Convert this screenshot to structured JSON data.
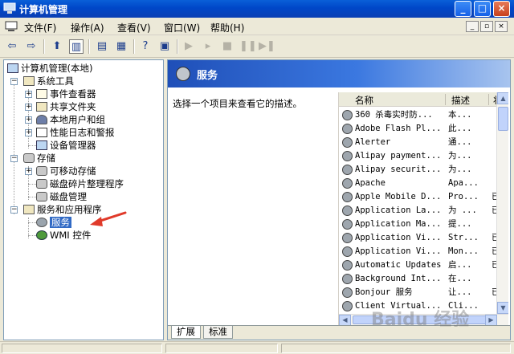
{
  "window": {
    "title": "计算机管理"
  },
  "menubar": {
    "items": [
      "文件(F)",
      "操作(A)",
      "查看(V)",
      "窗口(W)",
      "帮助(H)"
    ]
  },
  "tree": {
    "root": "计算机管理(本地)",
    "system_tools": "系统工具",
    "event_viewer": "事件查看器",
    "shared_folders": "共享文件夹",
    "local_users": "本地用户和组",
    "perf_logs": "性能日志和警报",
    "device_manager": "设备管理器",
    "storage": "存储",
    "removable_storage": "可移动存储",
    "defrag": "磁盘碎片整理程序",
    "disk_management": "磁盘管理",
    "services_apps": "服务和应用程序",
    "services": "服务",
    "wmi": "WMI 控件"
  },
  "details": {
    "header_title": "服务",
    "description_prompt": "选择一个项目来查看它的描述。",
    "columns": [
      "名称",
      "描述",
      "状"
    ],
    "rows": [
      {
        "name": "360 杀毒实时防...",
        "desc": "本...",
        "status": ""
      },
      {
        "name": "Adobe Flash Pl...",
        "desc": "此...",
        "status": ""
      },
      {
        "name": "Alerter",
        "desc": "通...",
        "status": ""
      },
      {
        "name": "Alipay payment...",
        "desc": "为...",
        "status": ""
      },
      {
        "name": "Alipay securit...",
        "desc": "为...",
        "status": ""
      },
      {
        "name": "Apache",
        "desc": "Apa...",
        "status": ""
      },
      {
        "name": "Apple Mobile D...",
        "desc": "Pro...",
        "status": "已"
      },
      {
        "name": "Application La...",
        "desc": "为 ...",
        "status": "已"
      },
      {
        "name": "Application Ma...",
        "desc": "提...",
        "status": ""
      },
      {
        "name": "Application Vi...",
        "desc": "Str...",
        "status": "已"
      },
      {
        "name": "Application Vi...",
        "desc": "Mon...",
        "status": "已"
      },
      {
        "name": "Automatic Updates",
        "desc": "启...",
        "status": "已"
      },
      {
        "name": "Background Int...",
        "desc": "在...",
        "status": ""
      },
      {
        "name": "Bonjour 服务",
        "desc": "让...",
        "status": "已"
      },
      {
        "name": "Client Virtual...",
        "desc": "Cli...",
        "status": ""
      }
    ],
    "tabs": [
      "扩展",
      "标准"
    ]
  },
  "watermark": "Baidu 经验",
  "colors": {
    "selection": "#316ac5",
    "titlebar": "#0047c8",
    "annotation_arrow": "#e03a2a"
  }
}
